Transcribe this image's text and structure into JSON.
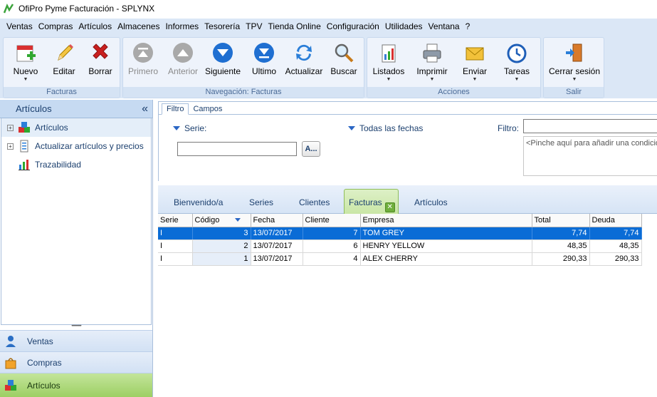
{
  "window": {
    "title": "OfiPro Pyme Facturación - SPLYNX"
  },
  "menu": [
    "Ventas",
    "Compras",
    "Artículos",
    "Almacenes",
    "Informes",
    "Tesorería",
    "TPV",
    "Tienda Online",
    "Configuración",
    "Utilidades",
    "Ventana",
    "?"
  ],
  "ribbon": {
    "facturas": {
      "title": "Facturas",
      "nuevo": "Nuevo",
      "editar": "Editar",
      "borrar": "Borrar"
    },
    "navegacion": {
      "title": "Navegación: Facturas",
      "primero": "Primero",
      "anterior": "Anterior",
      "siguiente": "Siguiente",
      "ultimo": "Ultimo",
      "actualizar": "Actualizar",
      "buscar": "Buscar"
    },
    "acciones": {
      "title": "Acciones",
      "listados": "Listados",
      "imprimir": "Imprimir",
      "enviar": "Enviar",
      "tareas": "Tareas"
    },
    "salir": {
      "title": "Salir",
      "cerrar": "Cerrar sesión"
    }
  },
  "sidebar": {
    "header": "Artículos",
    "collapse": "«",
    "items": [
      "Artículos",
      "Actualizar artículos y precios",
      "Trazabilidad"
    ],
    "nav": [
      "Ventas",
      "Compras",
      "Artículos"
    ]
  },
  "filter": {
    "tabs": [
      "Filtro",
      "Campos"
    ],
    "serie_label": "Serie:",
    "fechas_label": "Todas las fechas",
    "a_button": "A...",
    "filtro_label": "Filtro:",
    "condition_placeholder": "<Pinche aquí para añadir una condición>"
  },
  "doctabs": [
    "Bienvenido/a",
    "Series",
    "Clientes",
    "Facturas",
    "Artículos"
  ],
  "grid": {
    "columns": [
      "Serie",
      "Código",
      "Fecha",
      "Cliente",
      "Empresa",
      "Total",
      "Deuda"
    ],
    "rows": [
      [
        "I",
        "3",
        "13/07/2017",
        "7",
        "TOM GREY",
        "7,74",
        "7,74"
      ],
      [
        "I",
        "2",
        "13/07/2017",
        "6",
        "HENRY YELLOW",
        "48,35",
        "48,35"
      ],
      [
        "I",
        "1",
        "13/07/2017",
        "4",
        "ALEX CHERRY",
        "290,33",
        "290,33"
      ]
    ]
  },
  "colors": {
    "accent": "#0a6cd6",
    "ribbon": "#dbe7f6",
    "active_nav": "#9dcf64"
  }
}
